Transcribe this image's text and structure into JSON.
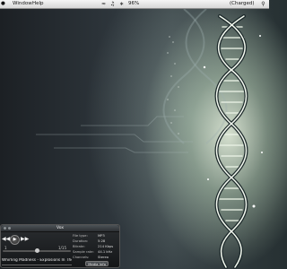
{
  "menubar": {
    "menus": [
      "Window",
      "Help"
    ],
    "battery": "96%",
    "user": "(Charged)",
    "extras": [
      "wifi-icon",
      "speaker-icon",
      "bluetooth-icon",
      "spotlight-icon"
    ]
  },
  "player": {
    "title": "Vox",
    "controls": {
      "prev": "◀◀",
      "play": "▶",
      "next": "▶▶"
    },
    "track_number": "1",
    "track_count": "1/15",
    "now_playing": "Whirling Madness - Explosions In The Sky",
    "info": [
      {
        "key": "File type:",
        "value": "MP3"
      },
      {
        "key": "Duration:",
        "value": "5:28"
      },
      {
        "key": "Bitrate:",
        "value": "214 Kbps"
      },
      {
        "key": "Sample rate:",
        "value": "44.1 kHz"
      },
      {
        "key": "Channels:",
        "value": "Stereo"
      }
    ],
    "media_info_label": "Media Info",
    "volume_level": 0.5
  },
  "colors": {
    "accent": "#e8f3dc",
    "panel": "#1c1f22"
  }
}
